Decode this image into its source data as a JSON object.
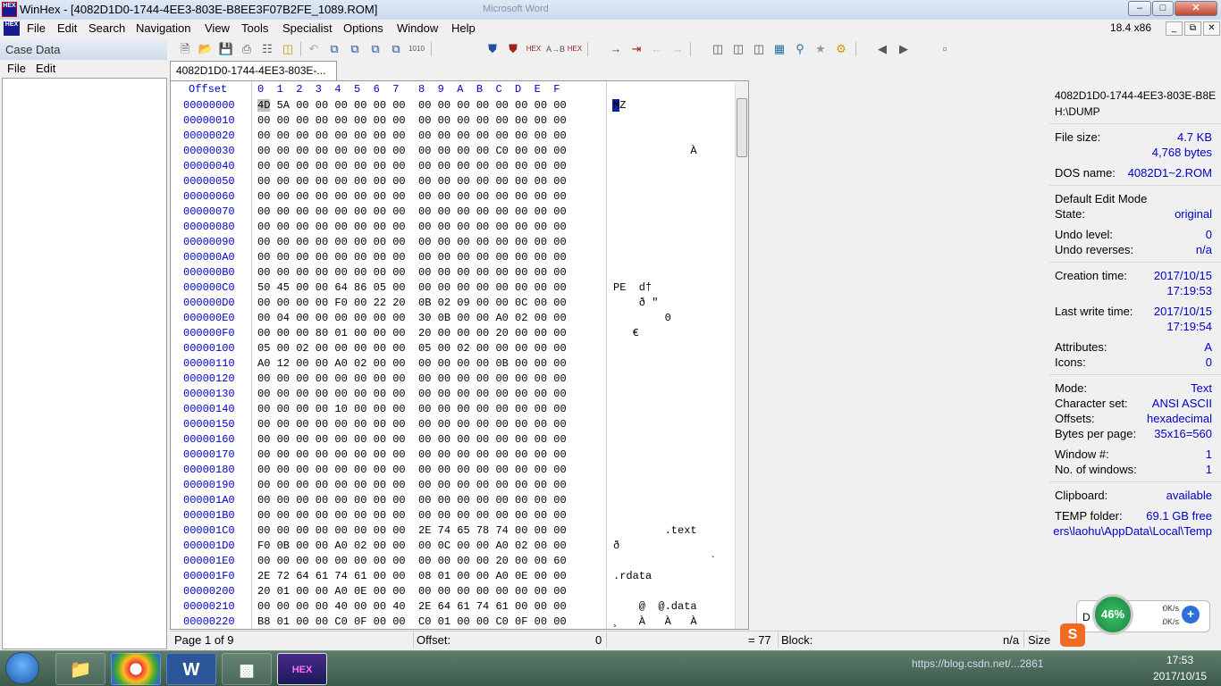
{
  "window": {
    "title": "WinHex - [4082D1D0-1744-4EE3-803E-B8EE3F07B2FE_1089.ROM]",
    "blurred_title": "Microsoft Word",
    "minimize": "‒",
    "maximize": "□",
    "close": "✕"
  },
  "app_icon": "HEX",
  "menu": [
    "File",
    "Edit",
    "Search",
    "Navigation",
    "View",
    "Tools",
    "Specialist",
    "Options",
    "Window",
    "Help"
  ],
  "size_indicator": "18.4 x86",
  "mdi_buttons": [
    "_",
    "⧉",
    "✕"
  ],
  "case_panel": {
    "title": "Case Data",
    "file": "File",
    "edit": "Edit"
  },
  "tab": "4082D1D0-1744-4EE3-803E-...",
  "hex": {
    "offset_header": "Offset",
    "col_header": "0  1  2  3  4  5  6  7   8  9  A  B  C  D  E  F",
    "rows": [
      {
        "off": "00000000",
        "hex": "4D 5A 00 00 00 00 00 00  00 00 00 00 00 00 00 00",
        "txt": "MZ"
      },
      {
        "off": "00000010",
        "hex": "00 00 00 00 00 00 00 00  00 00 00 00 00 00 00 00",
        "txt": ""
      },
      {
        "off": "00000020",
        "hex": "00 00 00 00 00 00 00 00  00 00 00 00 00 00 00 00",
        "txt": ""
      },
      {
        "off": "00000030",
        "hex": "00 00 00 00 00 00 00 00  00 00 00 00 C0 00 00 00",
        "txt": "            À"
      },
      {
        "off": "00000040",
        "hex": "00 00 00 00 00 00 00 00  00 00 00 00 00 00 00 00",
        "txt": ""
      },
      {
        "off": "00000050",
        "hex": "00 00 00 00 00 00 00 00  00 00 00 00 00 00 00 00",
        "txt": ""
      },
      {
        "off": "00000060",
        "hex": "00 00 00 00 00 00 00 00  00 00 00 00 00 00 00 00",
        "txt": ""
      },
      {
        "off": "00000070",
        "hex": "00 00 00 00 00 00 00 00  00 00 00 00 00 00 00 00",
        "txt": ""
      },
      {
        "off": "00000080",
        "hex": "00 00 00 00 00 00 00 00  00 00 00 00 00 00 00 00",
        "txt": ""
      },
      {
        "off": "00000090",
        "hex": "00 00 00 00 00 00 00 00  00 00 00 00 00 00 00 00",
        "txt": ""
      },
      {
        "off": "000000A0",
        "hex": "00 00 00 00 00 00 00 00  00 00 00 00 00 00 00 00",
        "txt": ""
      },
      {
        "off": "000000B0",
        "hex": "00 00 00 00 00 00 00 00  00 00 00 00 00 00 00 00",
        "txt": ""
      },
      {
        "off": "000000C0",
        "hex": "50 45 00 00 64 86 05 00  00 00 00 00 00 00 00 00",
        "txt": "PE  d†"
      },
      {
        "off": "000000D0",
        "hex": "00 00 00 00 F0 00 22 20  0B 02 09 00 00 0C 00 00",
        "txt": "    ð \""
      },
      {
        "off": "000000E0",
        "hex": "00 04 00 00 00 00 00 00  30 0B 00 00 A0 02 00 00",
        "txt": "        0"
      },
      {
        "off": "000000F0",
        "hex": "00 00 00 80 01 00 00 00  20 00 00 00 20 00 00 00",
        "txt": "   €"
      },
      {
        "off": "00000100",
        "hex": "05 00 02 00 00 00 00 00  05 00 02 00 00 00 00 00",
        "txt": ""
      },
      {
        "off": "00000110",
        "hex": "A0 12 00 00 A0 02 00 00  00 00 00 00 0B 00 00 00",
        "txt": ""
      },
      {
        "off": "00000120",
        "hex": "00 00 00 00 00 00 00 00  00 00 00 00 00 00 00 00",
        "txt": ""
      },
      {
        "off": "00000130",
        "hex": "00 00 00 00 00 00 00 00  00 00 00 00 00 00 00 00",
        "txt": ""
      },
      {
        "off": "00000140",
        "hex": "00 00 00 00 10 00 00 00  00 00 00 00 00 00 00 00",
        "txt": ""
      },
      {
        "off": "00000150",
        "hex": "00 00 00 00 00 00 00 00  00 00 00 00 00 00 00 00",
        "txt": ""
      },
      {
        "off": "00000160",
        "hex": "00 00 00 00 00 00 00 00  00 00 00 00 00 00 00 00",
        "txt": ""
      },
      {
        "off": "00000170",
        "hex": "00 00 00 00 00 00 00 00  00 00 00 00 00 00 00 00",
        "txt": ""
      },
      {
        "off": "00000180",
        "hex": "00 00 00 00 00 00 00 00  00 00 00 00 00 00 00 00",
        "txt": ""
      },
      {
        "off": "00000190",
        "hex": "00 00 00 00 00 00 00 00  00 00 00 00 00 00 00 00",
        "txt": ""
      },
      {
        "off": "000001A0",
        "hex": "00 00 00 00 00 00 00 00  00 00 00 00 00 00 00 00",
        "txt": ""
      },
      {
        "off": "000001B0",
        "hex": "00 00 00 00 00 00 00 00  00 00 00 00 00 00 00 00",
        "txt": ""
      },
      {
        "off": "000001C0",
        "hex": "00 00 00 00 00 00 00 00  2E 74 65 78 74 00 00 00",
        "txt": "        .text"
      },
      {
        "off": "000001D0",
        "hex": "F0 0B 00 00 A0 02 00 00  00 0C 00 00 A0 02 00 00",
        "txt": "ð"
      },
      {
        "off": "000001E0",
        "hex": "00 00 00 00 00 00 00 00  00 00 00 00 20 00 00 60",
        "txt": "               `"
      },
      {
        "off": "000001F0",
        "hex": "2E 72 64 61 74 61 00 00  08 01 00 00 A0 0E 00 00",
        "txt": ".rdata"
      },
      {
        "off": "00000200",
        "hex": "20 01 00 00 A0 0E 00 00  00 00 00 00 00 00 00 00",
        "txt": ""
      },
      {
        "off": "00000210",
        "hex": "00 00 00 00 40 00 00 40  2E 64 61 74 61 00 00 00",
        "txt": "    @  @.data"
      },
      {
        "off": "00000220",
        "hex": "B8 01 00 00 C0 0F 00 00  C0 01 00 00 C0 0F 00 00",
        "txt": "¸   À   À   À"
      }
    ]
  },
  "info": {
    "filename": "4082D1D0-1744-4EE3-803E-B8E",
    "path": "H:\\DUMP",
    "file_size_label": "File size:",
    "file_size_kb": "4.7 KB",
    "file_size_bytes": "4,768 bytes",
    "dos_name_label": "DOS name:",
    "dos_name": "4082D1~2.ROM",
    "edit_mode": "Default Edit Mode",
    "state_label": "State:",
    "state": "original",
    "undo_level_label": "Undo level:",
    "undo_level": "0",
    "undo_rev_label": "Undo reverses:",
    "undo_rev": "n/a",
    "creation_label": "Creation time:",
    "creation_date": "2017/10/15",
    "creation_time": "17:19:53",
    "write_label": "Last write time:",
    "write_date": "2017/10/15",
    "write_time": "17:19:54",
    "attr_label": "Attributes:",
    "attr": "A",
    "icons_label": "Icons:",
    "icons": "0",
    "mode_label": "Mode:",
    "mode": "Text",
    "charset_label": "Character set:",
    "charset": "ANSI ASCII",
    "offsets_label": "Offsets:",
    "offsets": "hexadecimal",
    "bpp_label": "Bytes per page:",
    "bpp": "35x16=560",
    "window_label": "Window #:",
    "window": "1",
    "nwin_label": "No. of windows:",
    "nwin": "1",
    "clip_label": "Clipboard:",
    "clip": "available",
    "temp_label": "TEMP folder:",
    "temp": "69.1 GB free",
    "temp_path": "ers\\laohu\\AppData\\Local\\Temp"
  },
  "status": {
    "page": "Page 1 of 9",
    "offset_label": "Offset:",
    "offset_val": "0",
    "eq": "= 77",
    "block_label": "Block:",
    "block_val": "n/a",
    "size_label": "Size"
  },
  "gauge": {
    "percent": "46%",
    "up": "0K/s",
    "down": "0K/s",
    "letter": "D"
  },
  "taskbar": {
    "hex_app": "HEX",
    "time": "17:53",
    "date": "2017/10/15",
    "tray_text": "https://blog.csdn.net/...2861"
  }
}
